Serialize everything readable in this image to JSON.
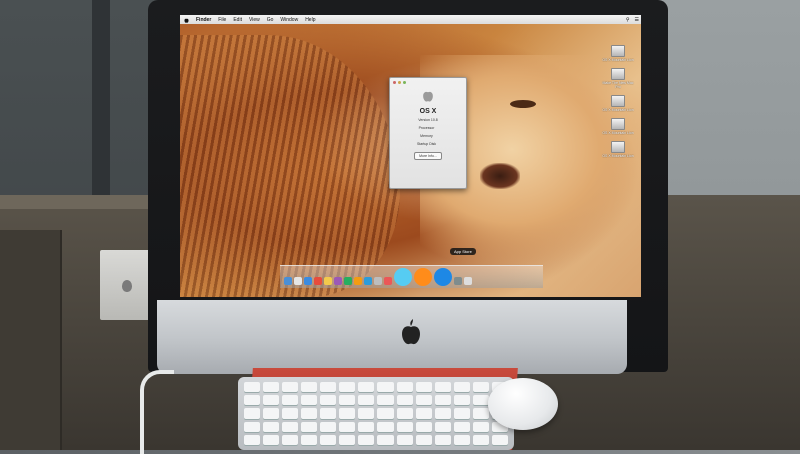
{
  "menubar": {
    "items": [
      "Finder",
      "File",
      "Edit",
      "View",
      "Go",
      "Window",
      "Help"
    ]
  },
  "about_window": {
    "os_name": "OS X",
    "version_line": "Version 10.8",
    "rows": [
      {
        "label": "Processor",
        "value": ""
      },
      {
        "label": "Memory",
        "value": ""
      },
      {
        "label": "Startup Disk",
        "value": ""
      }
    ],
    "button_label": "More Info...",
    "footer": ""
  },
  "desktop_icons": [
    {
      "label": "OS X Mountain Lion"
    },
    {
      "label": "Make The New Mac Pro"
    },
    {
      "label": "OS X Mountain Lion"
    },
    {
      "label": "OS X Mountain Lion"
    },
    {
      "label": "OS X Mountain Lion"
    }
  ],
  "dock": {
    "tooltip": "App Store",
    "item_colors": [
      "#4a8fd6",
      "#e5e5e5",
      "#3c8be0",
      "#e74c3c",
      "#f2c94c",
      "#9b59b6",
      "#27ae60",
      "#f39c12",
      "#2d9cdb",
      "#bdbdbd",
      "#eb5757",
      "#56ccf2",
      "#ff8c1a",
      "#1e88e5",
      "#7f8c8d",
      "#dddddd"
    ]
  },
  "colors": {
    "screen_bg": "#b9652b",
    "chin": "#c0c4c8"
  }
}
